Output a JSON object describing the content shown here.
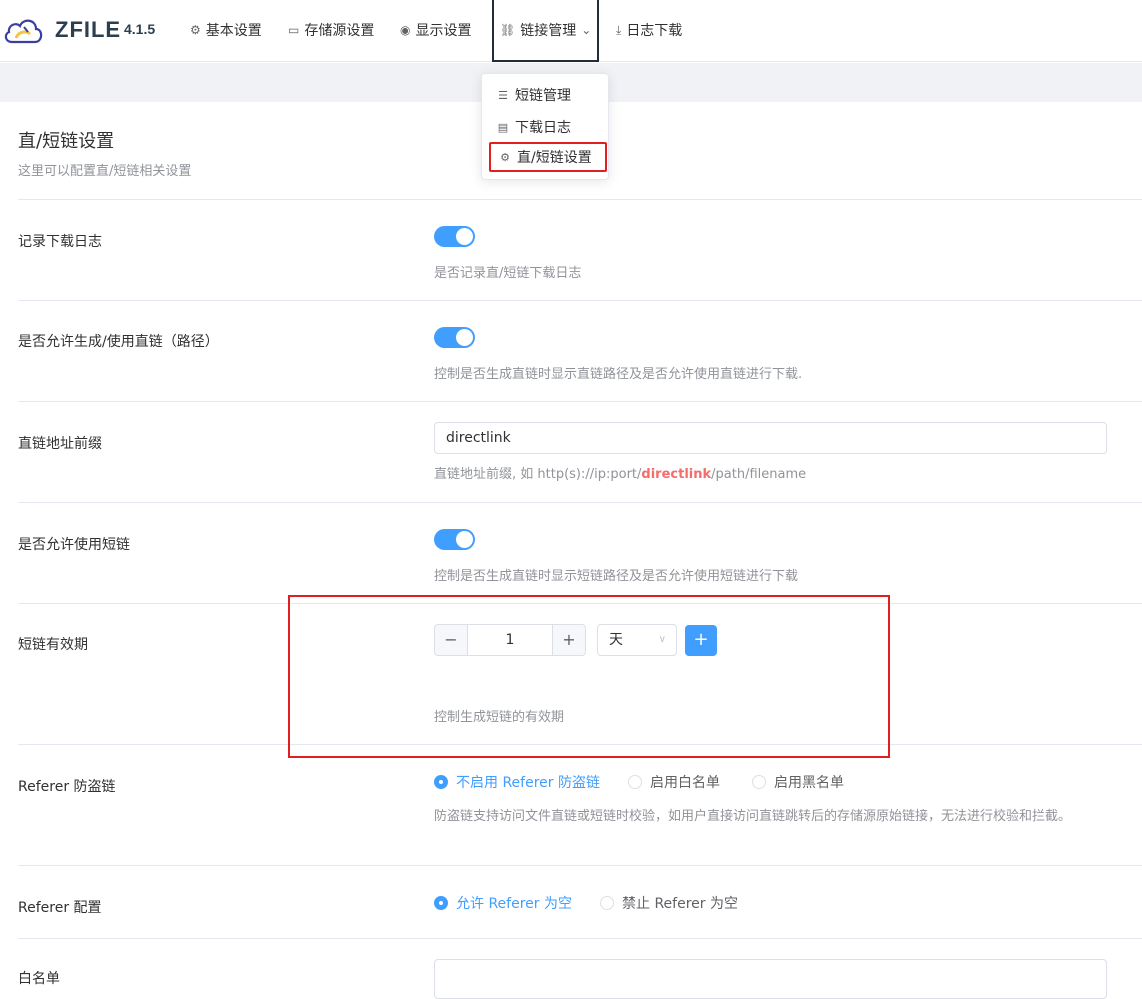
{
  "app": {
    "brand": "ZFILE",
    "version": "4.1.5"
  },
  "nav": [
    {
      "icon": "gear-icon",
      "glyph": "⚙",
      "label": "基本设置"
    },
    {
      "icon": "folder-icon",
      "glyph": "▭",
      "label": "存储源设置"
    },
    {
      "icon": "eye-icon",
      "glyph": "◉",
      "label": "显示设置"
    },
    {
      "icon": "link-icon",
      "glyph": "🔗",
      "label": "链接管理",
      "active": true
    },
    {
      "icon": "download-icon",
      "glyph": "⤓",
      "label": "日志下载"
    }
  ],
  "dropdown": [
    {
      "icon": "list-icon",
      "glyph": "☰",
      "label": "短链管理"
    },
    {
      "icon": "document-icon",
      "glyph": "▤",
      "label": "下载日志"
    },
    {
      "icon": "gear-icon",
      "glyph": "⚙",
      "label": "直/短链设置",
      "highlighted": true
    }
  ],
  "page": {
    "title": "直/短链设置",
    "subtitle": "这里可以配置直/短链相关设置"
  },
  "settings": {
    "record_log": {
      "label": "记录下载日志",
      "help": "是否记录直/短链下载日志",
      "enabled": true
    },
    "allow_direct": {
      "label": "是否允许生成/使用直链（路径）",
      "help": "控制是否生成直链时显示直链路径及是否允许使用直链进行下载.",
      "enabled": true
    },
    "direct_prefix": {
      "label": "直链地址前缀",
      "value": "directlink",
      "help_pre": "直链地址前缀, 如 http(s)://ip:port/",
      "help_kw": "directlink",
      "help_post": "/path/filename"
    },
    "allow_short": {
      "label": "是否允许使用短链",
      "help": "控制是否生成直链时显示短链路径及是否允许使用短链进行下载",
      "enabled": true
    },
    "short_expire": {
      "label": "短链有效期",
      "value": "1",
      "unit": "天",
      "help": "控制生成短链的有效期",
      "minus": "−",
      "plus": "+",
      "add": "+"
    },
    "referer": {
      "label": "Referer 防盗链",
      "options": [
        "不启用 Referer 防盗链",
        "启用白名单",
        "启用黑名单"
      ],
      "selected": 0,
      "help": "防盗链支持访问文件直链或短链时校验，如用户直接访问直链跳转后的存储源原始链接，无法进行校验和拦截。"
    },
    "referer_config": {
      "label": "Referer 配置",
      "options": [
        "允许 Referer 为空",
        "禁止 Referer 为空"
      ],
      "selected": 0
    },
    "whitelist": {
      "label": "白名单"
    }
  },
  "colors": {
    "accent": "#409eff",
    "annotation": "#e02020",
    "keyword": "#f56c6c"
  }
}
